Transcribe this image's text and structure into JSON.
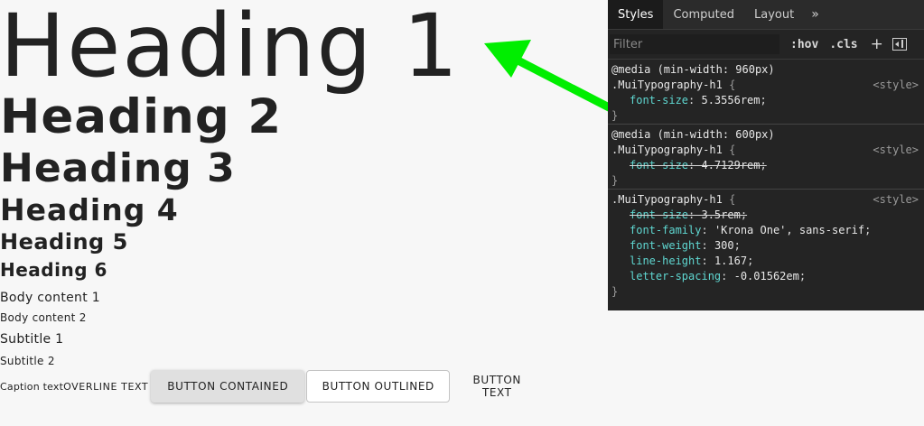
{
  "typography": {
    "h1": "Heading 1",
    "h2": "Heading 2",
    "h3": "Heading 3",
    "h4": "Heading 4",
    "h5": "Heading 5",
    "h6": "Heading 6",
    "body1": "Body content 1",
    "body2": "Body content 2",
    "subtitle1": "Subtitle 1",
    "subtitle2": "Subtitle 2",
    "caption": "Caption text",
    "overline": "OVERLINE TEXT"
  },
  "buttons": {
    "contained": "BUTTON CONTAINED",
    "outlined": "BUTTON OUTLINED",
    "text": "BUTTON TEXT"
  },
  "annotation": {
    "arrow_color": "#00ee00",
    "icon": "arrow-icon"
  },
  "devtools": {
    "tabs": [
      "Styles",
      "Computed",
      "Layout"
    ],
    "more": "»",
    "filter_placeholder": "Filter",
    "hov": ":hov",
    "cls": ".cls",
    "plus": "+",
    "rules": [
      {
        "media": "@media (min-width: 960px)",
        "selector": ".MuiTypography-h1",
        "source": "<style>",
        "props": [
          {
            "name": "font-size",
            "value": "5.3556rem",
            "struck": false
          }
        ]
      },
      {
        "media": "@media (min-width: 600px)",
        "selector": ".MuiTypography-h1",
        "source": "<style>",
        "props": [
          {
            "name": "font-size",
            "value": "4.7129rem",
            "struck": true
          }
        ]
      },
      {
        "media": "",
        "selector": ".MuiTypography-h1",
        "source": "<style>",
        "props": [
          {
            "name": "font-size",
            "value": "3.5rem",
            "struck": true
          },
          {
            "name": "font-family",
            "value": "'Krona One', sans-serif",
            "struck": false
          },
          {
            "name": "font-weight",
            "value": "300",
            "struck": false
          },
          {
            "name": "line-height",
            "value": "1.167",
            "struck": false
          },
          {
            "name": "letter-spacing",
            "value": "-0.01562em",
            "struck": false
          }
        ]
      }
    ]
  }
}
